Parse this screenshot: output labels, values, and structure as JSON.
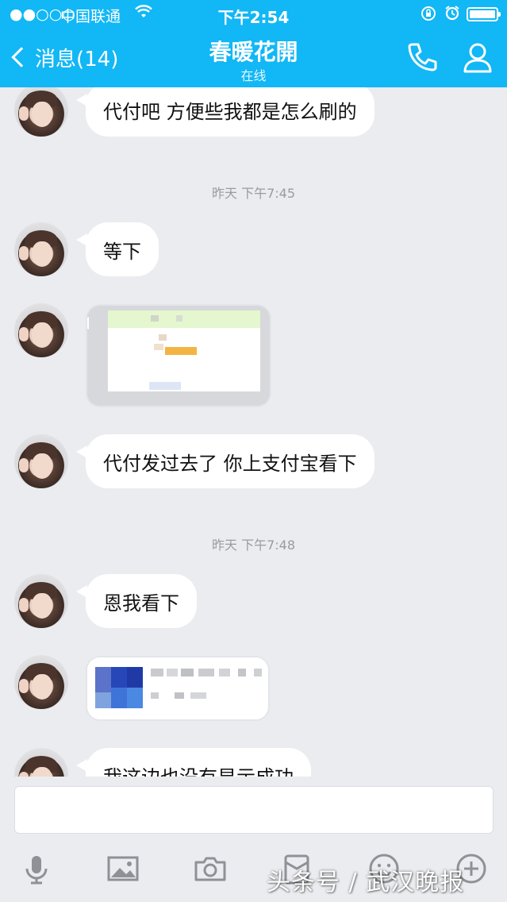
{
  "status_bar": {
    "signal": "●●○○○",
    "carrier": "中国联通",
    "time": "下午2:54"
  },
  "nav": {
    "back_label": "消息(14)",
    "title": "春暖花開",
    "subtitle": "在线"
  },
  "messages": [
    {
      "type": "text",
      "text": "代付吧   方便些我都是怎么刷的"
    },
    {
      "type": "timestamp",
      "text": "昨天  下午7:45"
    },
    {
      "type": "text",
      "text": "等下"
    },
    {
      "type": "image"
    },
    {
      "type": "text",
      "text": "代付发过去了   你上支付宝看下"
    },
    {
      "type": "timestamp",
      "text": "昨天  下午7:48"
    },
    {
      "type": "text",
      "text": "恩我看下"
    },
    {
      "type": "image"
    },
    {
      "type": "text",
      "text": "我这边也没有显示成功"
    }
  ],
  "toolbar": {
    "icons": [
      "microphone-icon",
      "image-icon",
      "camera-icon",
      "red-packet-icon",
      "emoji-icon",
      "plus-icon"
    ]
  },
  "watermark": "头条号 / 武汉晚报",
  "colors": {
    "header": "#12b7f5",
    "background": "#ebecf0",
    "bubble": "#ffffff"
  }
}
